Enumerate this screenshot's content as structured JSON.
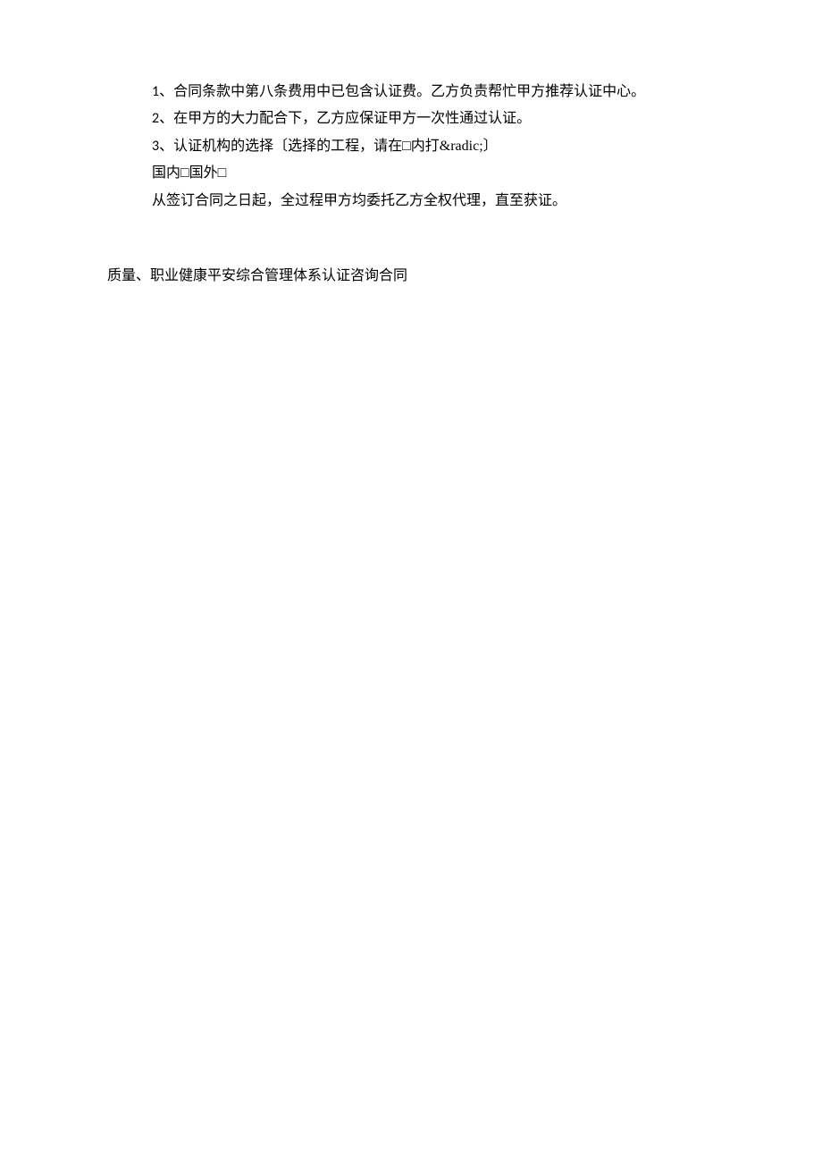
{
  "paragraphs": {
    "p1_num": "1",
    "p1_text": "、合同条款中第八条费用中已包含认证费。乙方负责帮忙甲方推荐认证中心。",
    "p2_num": "2",
    "p2_text": "、在甲方的大力配合下，乙方应保证甲方一次性通过认证。",
    "p3_num": "3",
    "p3_text": "、认证机构的选择〔选择的工程，请在□内打&radic;〕",
    "p4": "国内□国外□",
    "p5": "从签订合同之日起，全过程甲方均委托乙方全权代理，直至获证。"
  },
  "footer": "质量、职业健康平安综合管理体系认证咨询合同"
}
